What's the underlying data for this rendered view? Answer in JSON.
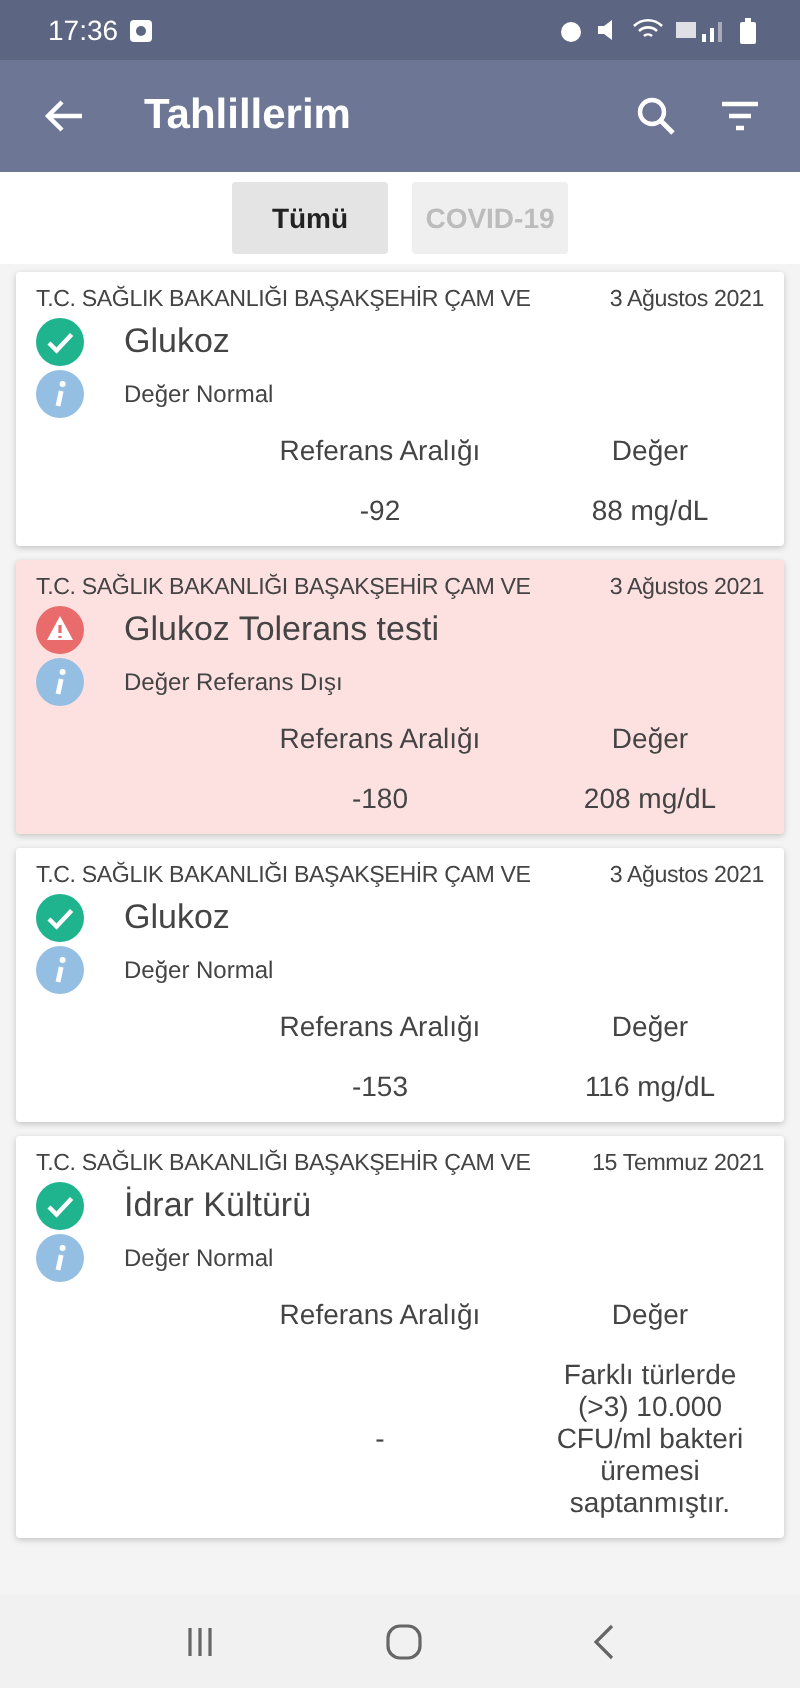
{
  "status_bar": {
    "time": "17:36"
  },
  "app_bar": {
    "title": "Tahlillerim"
  },
  "tabs": [
    {
      "label": "Tümü",
      "selected": true
    },
    {
      "label": "COVID-19",
      "selected": false
    }
  ],
  "results": [
    {
      "institution": "T.C. SAĞLIK BAKANLIĞI BAŞAKŞEHİR ÇAM VE",
      "date": "3 Ağustos 2021",
      "test": "Glukoz",
      "kind": "normal",
      "status": "Değer Normal",
      "reference_label": "Referans Aralığı",
      "value_label": "Değer",
      "reference": "-92",
      "value": "88 mg/dL"
    },
    {
      "institution": "T.C. SAĞLIK BAKANLIĞI BAŞAKŞEHİR ÇAM VE",
      "date": "3 Ağustos 2021",
      "test": "Glukoz Tolerans testi",
      "kind": "abnormal",
      "status": "Değer Referans Dışı",
      "reference_label": "Referans Aralığı",
      "value_label": "Değer",
      "reference": "-180",
      "value": "208 mg/dL"
    },
    {
      "institution": "T.C. SAĞLIK BAKANLIĞI BAŞAKŞEHİR ÇAM VE",
      "date": "3 Ağustos 2021",
      "test": "Glukoz",
      "kind": "normal",
      "status": "Değer Normal",
      "reference_label": "Referans Aralığı",
      "value_label": "Değer",
      "reference": "-153",
      "value": "116 mg/dL"
    },
    {
      "institution": "T.C. SAĞLIK BAKANLIĞI BAŞAKŞEHİR ÇAM VE",
      "date": "15 Temmuz 2021",
      "test": "İdrar Kültürü",
      "kind": "normal",
      "status": "Değer Normal",
      "reference_label": "Referans Aralığı",
      "value_label": "Değer",
      "reference": "-",
      "value": "Farklı türlerde (>3) 10.000 CFU/ml bakteri üremesi saptanmıştır."
    }
  ]
}
